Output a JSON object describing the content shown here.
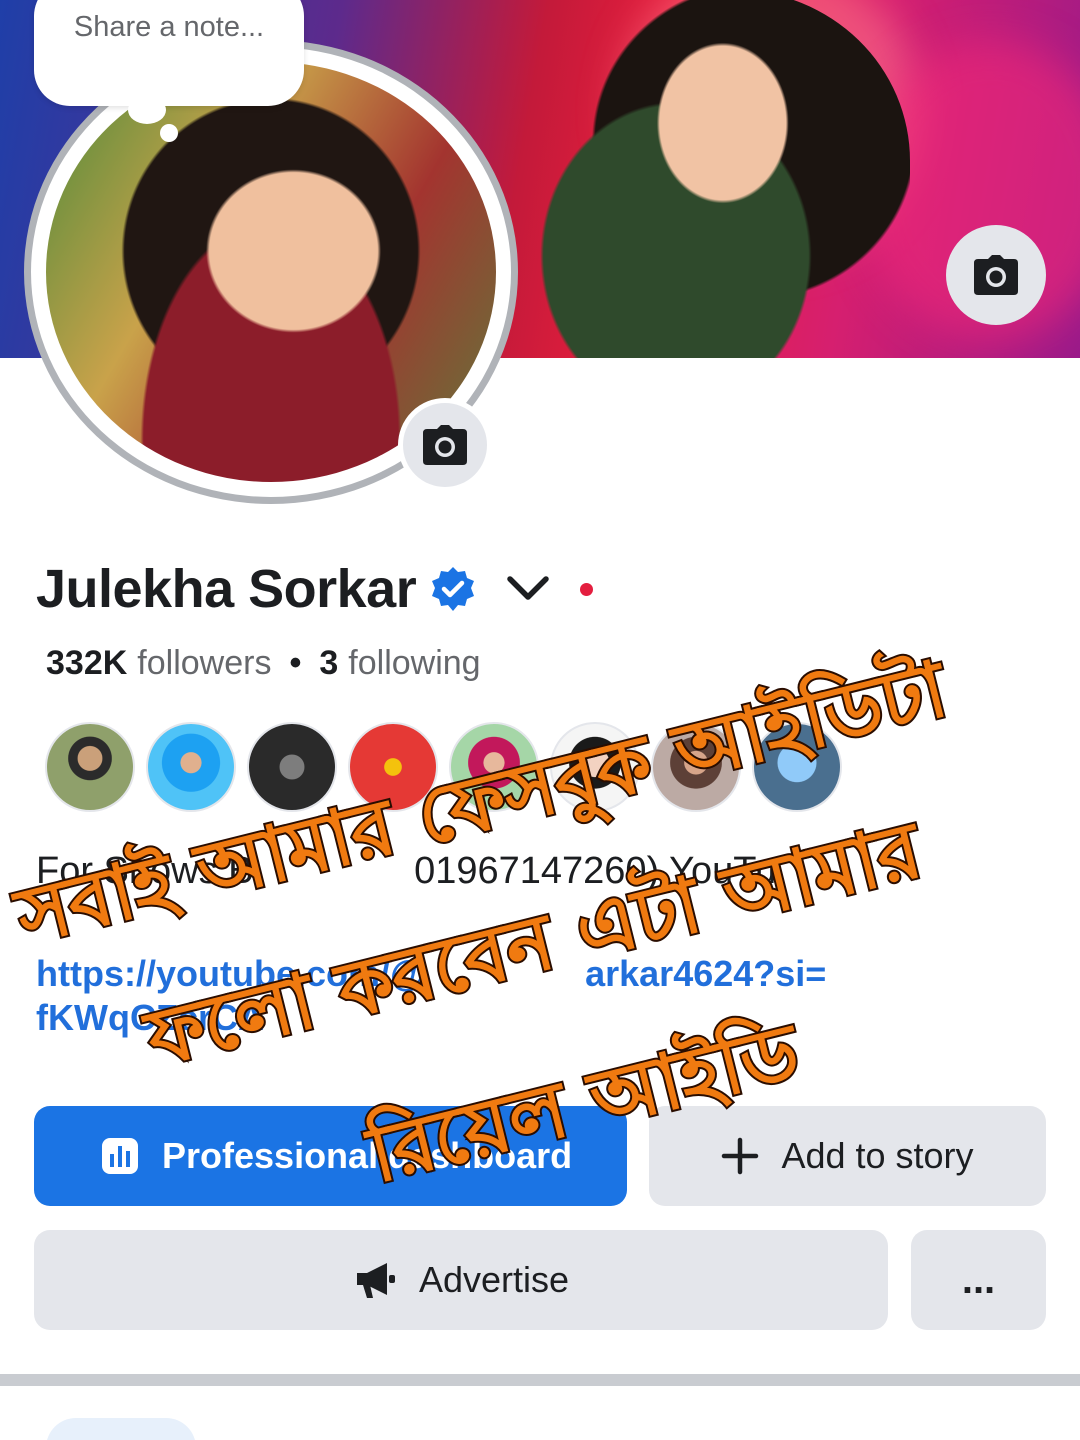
{
  "note": {
    "placeholder": "Share a note..."
  },
  "profile": {
    "name": "Julekha Sorkar",
    "followers_count": "332K",
    "followers_label": "followers",
    "separator": "•",
    "following_count": "3",
    "following_label": "following"
  },
  "friends": {
    "avatars": [
      "friend-1",
      "friend-2",
      "friend-3",
      "friend-4",
      "friend-5",
      "friend-6",
      "friend-7",
      "friend-8"
    ]
  },
  "bio": {
    "text": "For Shows B",
    "text_partial_2": "01967147260) YouTu",
    "link_line1": "https://youtube.com/@",
    "link_line1_end": "arkar4624?si=",
    "link_line2": "fKWqCZcrCA"
  },
  "buttons": {
    "professional_dashboard": "Professional dashboard",
    "add_to_story": "Add to story",
    "advertise": "Advertise",
    "more": "..."
  },
  "overlay": {
    "line1": "সবাই আমার ফেসবুক আইডিটা",
    "line2": "ফলো করবেন এটা আমার",
    "line3": "রিয়েল আইডি"
  },
  "colors": {
    "primary": "#1b74e4",
    "secondary_button": "#e4e6eb",
    "link": "#216fdb",
    "overlay_fill": "#f07a10",
    "live_dot": "#e41e3f"
  },
  "icons": [
    "camera-icon",
    "verified-badge-icon",
    "chevron-down-icon",
    "dashboard-icon",
    "plus-icon",
    "megaphone-icon"
  ]
}
